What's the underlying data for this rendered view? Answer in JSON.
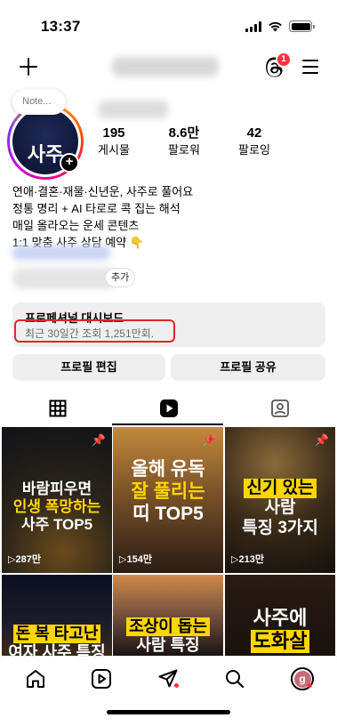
{
  "status_bar": {
    "time": "13:37"
  },
  "top_nav": {
    "threads_badge": "1"
  },
  "profile": {
    "note_label": "Note...",
    "avatar_text": "사주",
    "stats": [
      {
        "value": "195",
        "label": "게시물"
      },
      {
        "value": "8.6만",
        "label": "팔로워"
      },
      {
        "value": "42",
        "label": "팔로잉"
      }
    ],
    "bio": [
      "연애·결혼·재물·신년운, 사주로 풀어요",
      "정통 명리 + AI 타로로 콕 집는 해석",
      "매일 올라오는 운세 콘텐츠",
      "1:1 맞춤 사주 상담 예약 👇"
    ],
    "add_chip": "추가"
  },
  "dashboard": {
    "title": "프로페셔널 대시보드",
    "subtitle": "최근 30일간 조회 1,251만회."
  },
  "buttons": {
    "edit_profile": "프로필 편집",
    "share_profile": "프로필 공유"
  },
  "grid": [
    {
      "lines": [
        "바람피우면",
        "인생 폭망하는",
        "사주 TOP5"
      ],
      "views": "287만",
      "pinned": true
    },
    {
      "lines": [
        "올해 유독",
        "잘 풀리는",
        "띠 TOP5"
      ],
      "views": "154만",
      "pinned": true
    },
    {
      "lines": [
        "신기 있는",
        "사람",
        "특징 3가지"
      ],
      "views": "213만",
      "pinned": true
    },
    {
      "lines": [
        "돈 복 타고난",
        "여자 사주 특징"
      ],
      "views": "",
      "pinned": false
    },
    {
      "lines": [
        "조상이 돕는",
        "사람 특징"
      ],
      "views": "",
      "pinned": false
    },
    {
      "lines": [
        "사주에",
        "도화살"
      ],
      "views": "",
      "pinned": false
    }
  ],
  "colors": {
    "accent_yellow": "#ffd600",
    "notification_red": "#ff3040",
    "highlight_red": "#e0262a"
  },
  "bottom_nav": {
    "profile_initial": "g"
  }
}
